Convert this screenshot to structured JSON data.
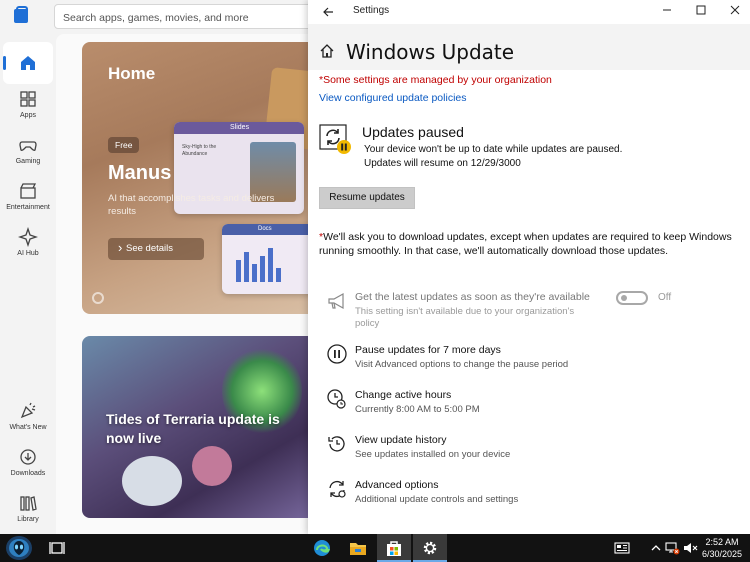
{
  "store": {
    "search_placeholder": "Search apps, games, movies, and more",
    "nav": [
      {
        "label": ""
      },
      {
        "label": "Apps"
      },
      {
        "label": "Gaming"
      },
      {
        "label": "Entertainment"
      },
      {
        "label": "AI Hub"
      },
      {
        "label": "What's New"
      },
      {
        "label": "Downloads"
      },
      {
        "label": "Library"
      }
    ],
    "hero": {
      "title": "Home",
      "badge": "Free",
      "app_name": "Manus",
      "subtitle": "AI that accomplishes tasks and delivers results",
      "cta": "See details",
      "slide_label": "Slides",
      "slide_heading": "Sky-High to the Abundance",
      "doc_label": "Docs"
    },
    "promo_title": "Tides of Terraria update is now live"
  },
  "settings": {
    "window_title": "Settings",
    "page_title": "Windows Update",
    "managed_notice": "*Some settings are managed by your organization",
    "policies_link": "View configured update policies",
    "status": {
      "title": "Updates paused",
      "line1": "Your device won't be up to date while updates are paused.",
      "line2": "Updates will resume on 12/29/3000"
    },
    "resume_button": "Resume updates",
    "notice_star": "*",
    "notice_text": "We'll ask you to download updates, except when updates are required to keep Windows running smoothly. In that case, we'll automatically download those updates.",
    "options": [
      {
        "title": "Get the latest updates as soon as they're available",
        "subtitle": "This setting isn't available due to your organization's policy",
        "toggle_label": "Off",
        "icon": "megaphone-icon"
      },
      {
        "title": "Pause updates for 7 more days",
        "subtitle": "Visit Advanced options to change the pause period",
        "icon": "pause-icon"
      },
      {
        "title": "Change active hours",
        "subtitle": "Currently 8:00 AM to 5:00 PM",
        "icon": "clock-icon"
      },
      {
        "title": "View update history",
        "subtitle": "See updates installed on your device",
        "icon": "history-icon"
      },
      {
        "title": "Advanced options",
        "subtitle": "Additional update controls and settings",
        "icon": "sync-gear-icon"
      }
    ]
  },
  "taskbar": {
    "time": "2:52 AM",
    "date": "6/30/2025"
  },
  "colors": {
    "accent": "#0a59c2",
    "warning": "#c00000",
    "taskbar": "#121212"
  }
}
